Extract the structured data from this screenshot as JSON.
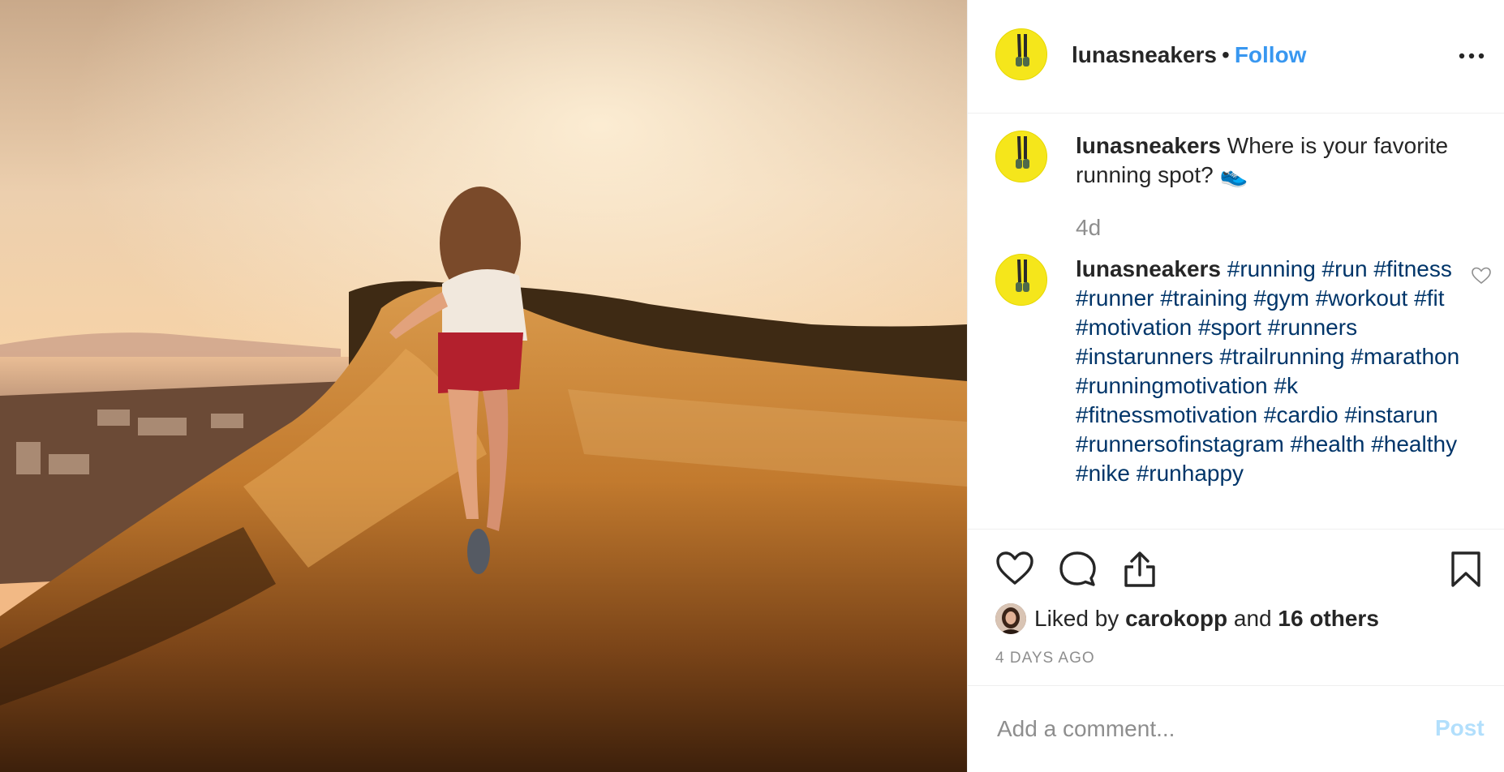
{
  "post": {
    "username": "lunasneakers",
    "separator": "•",
    "follow_label": "Follow",
    "more_icon": "more-horizontal-icon",
    "photo_alt": "Woman running through golden grass on a hilltop at sunset"
  },
  "comments": [
    {
      "username": "lunasneakers",
      "text": "Where is your favorite running spot? 👟",
      "time": "4d"
    },
    {
      "username": "lunasneakers",
      "hashtags": "#running #run #fitness #runner #training #gym #workout #fit #motivation #sport #runners #instarunners #trailrunning #marathon #runningmotivation #k #fitnessmotivation #cardio #instarun #runnersofinstagram #health #healthy #nike #runhappy"
    }
  ],
  "actions": {
    "icons": [
      "heart-icon",
      "comment-icon",
      "share-icon",
      "bookmark-icon"
    ],
    "liked_by_prefix": "Liked by",
    "liked_by_user": "carokopp",
    "liked_by_and": "and",
    "liked_by_others": "16 others",
    "post_time": "4 DAYS AGO"
  },
  "comment_box": {
    "placeholder": "Add a comment...",
    "post_label": "Post"
  },
  "colors": {
    "link": "#3897f0",
    "hashtag": "#003569",
    "post_disabled": "#b2dffc",
    "avatar_bg": "#f5e61b"
  }
}
